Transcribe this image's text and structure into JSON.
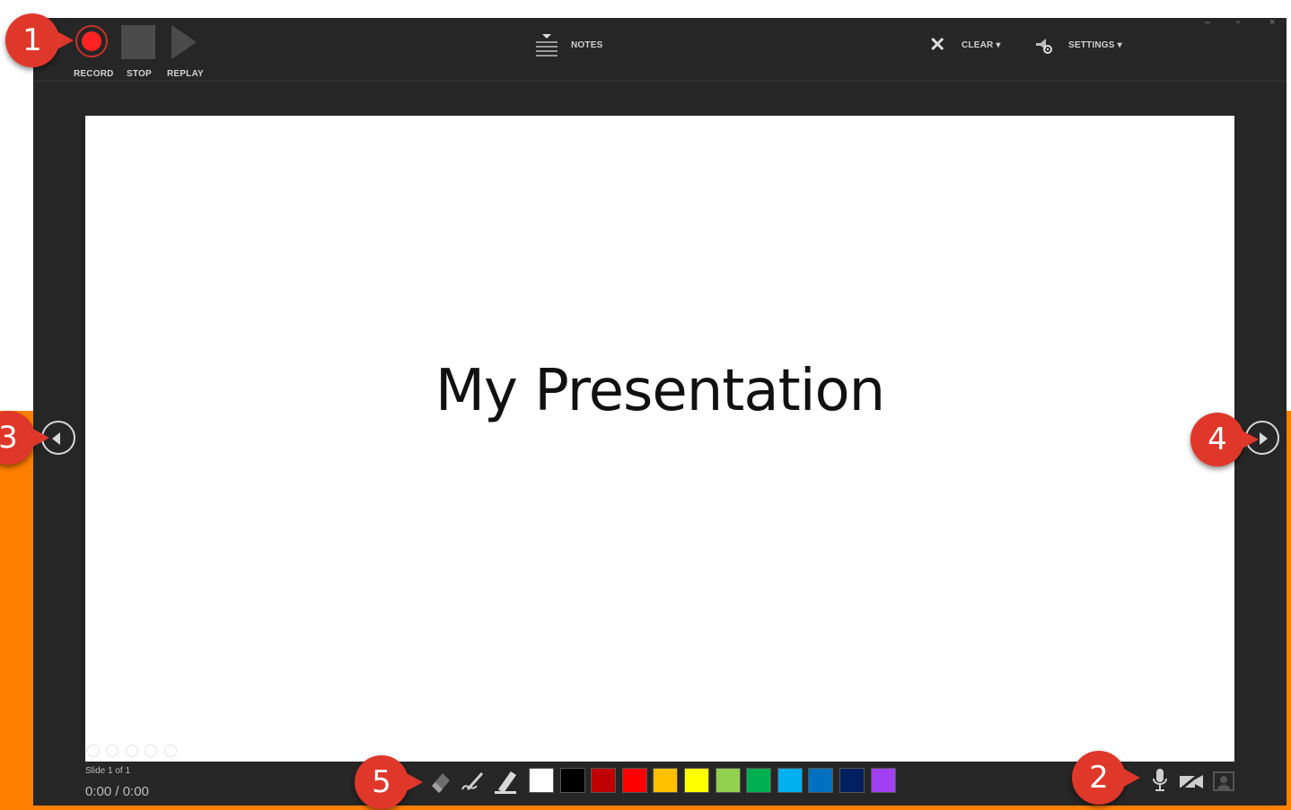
{
  "window": {
    "minimize_glyph": "–",
    "maximize_glyph": "▫",
    "close_glyph": "×"
  },
  "toolbar": {
    "record_label": "RECORD",
    "stop_label": "STOP",
    "replay_label": "REPLAY",
    "notes_label": "NOTES",
    "clear_label": "CLEAR ▾",
    "settings_label": "SETTINGS ▾"
  },
  "slide": {
    "title": "My Presentation"
  },
  "status": {
    "slide_count": "Slide 1 of 1",
    "time": "0:00  /  0:00"
  },
  "pen_tools": [
    "eraser-icon",
    "pen-icon",
    "highlighter-icon"
  ],
  "swatch_colors": [
    "#ffffff",
    "#000000",
    "#c00000",
    "#ff0000",
    "#ffc000",
    "#ffff00",
    "#92d050",
    "#00b050",
    "#00b0f0",
    "#0070c0",
    "#002060",
    "#a040f0"
  ],
  "callouts": {
    "b1": "1",
    "b2": "2",
    "b3": "3",
    "b4": "4",
    "b5": "5"
  },
  "colors": {
    "window_bg": "#262626",
    "record_red": "#ff2222",
    "callout_red": "#e0372b",
    "accent_orange": "#ff7f00"
  }
}
